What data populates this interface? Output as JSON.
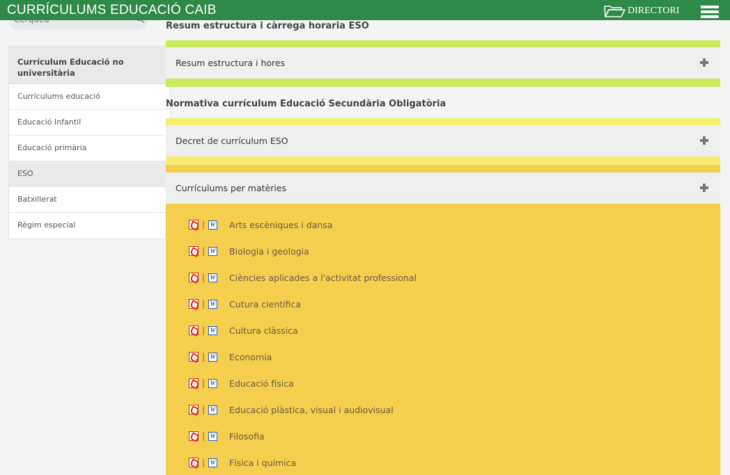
{
  "header": {
    "brand": "CURRÍCULUMS EDUCACIÓ CAIB",
    "directory_label": "DIRECTORI"
  },
  "search": {
    "placeholder": "Cerqueu"
  },
  "sidebar": {
    "heading": "Currículum Educació no universitària",
    "items": [
      {
        "label": "Currículums educació"
      },
      {
        "label": "Educació Infantil"
      },
      {
        "label": "Educació primària"
      },
      {
        "label": "ESO"
      },
      {
        "label": "Batxillerat"
      },
      {
        "label": "Règim especial"
      }
    ]
  },
  "main": {
    "section1_title": "Resum estructura i càrrega horaria ESO",
    "accordion1_label": "Resum estructura i hores",
    "section2_title": "Normativa currículum Educació Secundària Obligatòria",
    "accordion2_label": "Decret de currículum ESO",
    "accordion3_label": "Currículums per matèries",
    "subjects": [
      "Arts escèniques i dansa",
      "Biologia i geologia",
      "Ciències aplicades a l'activitat professional",
      "Cutura científica",
      "Cultura clàssica",
      "Economia",
      "Educació física",
      "Educació plàstica, visual i audiovisual",
      "Filosofia",
      "Física i química"
    ],
    "icon_separator": "|",
    "doc_glyph": "W"
  },
  "colors": {
    "topbar": "#2f8a47",
    "band_green": "#c8ec5a",
    "band_yellow": "#f5ee72",
    "band_orange": "#f5ce4e"
  }
}
